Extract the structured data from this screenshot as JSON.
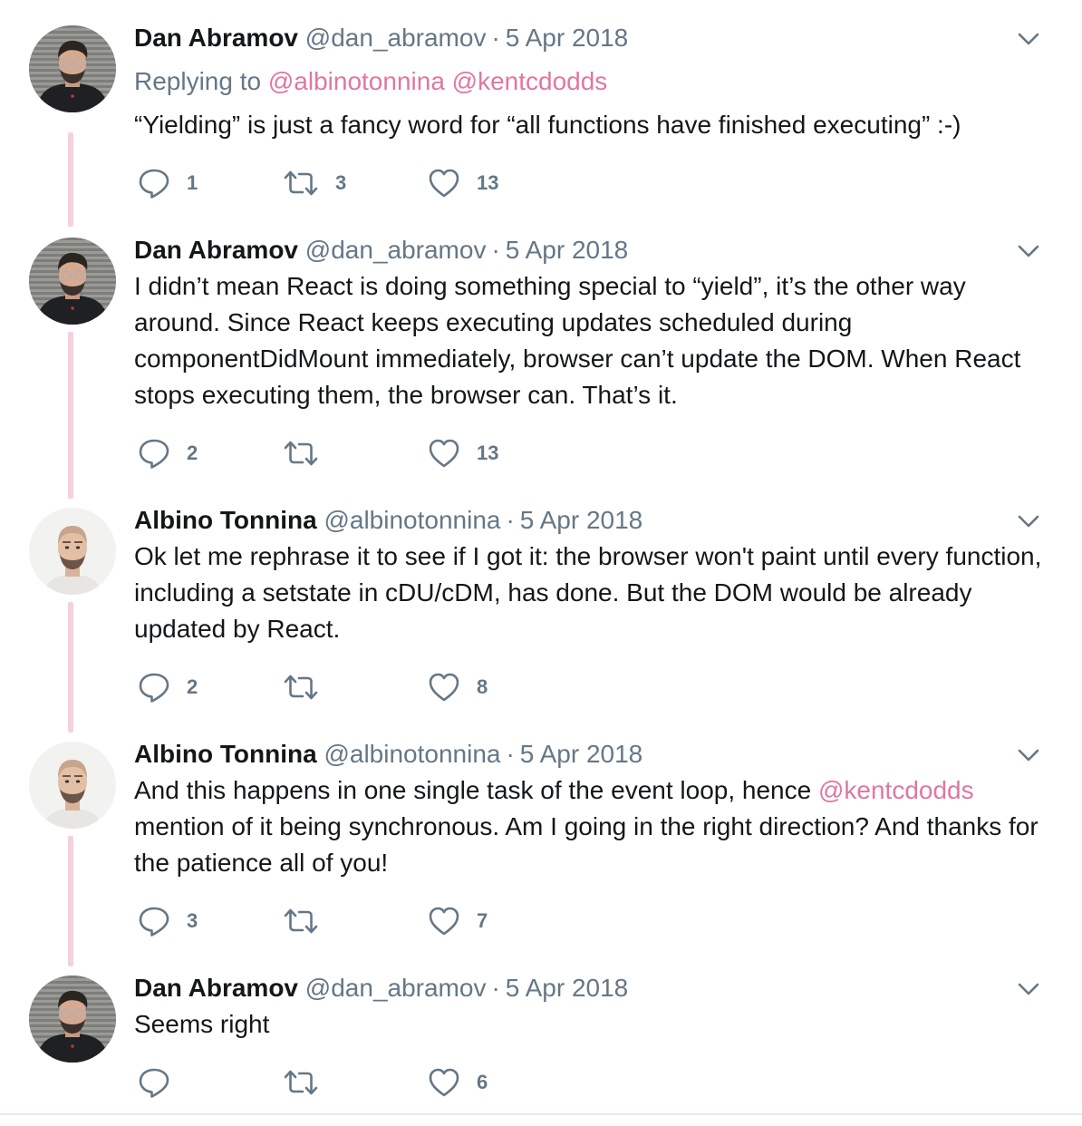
{
  "tweets": [
    {
      "name": "Dan Abramov",
      "handle": "@dan_abramov",
      "separator": "·",
      "date": "5 Apr 2018",
      "replying_prefix": "Replying to",
      "replying_mentions": [
        "@albinotonnina",
        "@kentcdodds"
      ],
      "text": "“Yielding” is just a fancy word for “all functions have finished executing” :-)",
      "replies": "1",
      "retweets": "3",
      "likes": "13",
      "avatar_icon": "dan-abramov-avatar"
    },
    {
      "name": "Dan Abramov",
      "handle": "@dan_abramov",
      "separator": "·",
      "date": "5 Apr 2018",
      "text": "I didn’t mean React is doing something special to “yield”, it’s the other way around. Since React keeps executing updates scheduled during componentDidMount immediately, browser can’t update the DOM. When React stops executing them, the browser can. That’s it.",
      "replies": "2",
      "retweets": "",
      "likes": "13",
      "avatar_icon": "dan-abramov-avatar"
    },
    {
      "name": "Albino Tonnina",
      "handle": "@albinotonnina",
      "separator": "·",
      "date": "5 Apr 2018",
      "text": "Ok let me rephrase it to see if I got it: the browser won't paint until every function, including a setstate in cDU/cDM, has done. But the DOM would be already updated by React.",
      "replies": "2",
      "retweets": "",
      "likes": "8",
      "avatar_icon": "albino-tonnina-avatar"
    },
    {
      "name": "Albino Tonnina",
      "handle": "@albinotonnina",
      "separator": "·",
      "date": "5 Apr 2018",
      "text_before": "And this happens in one single task of the event loop, hence ",
      "text_mention": "@kentcdodds",
      "text_after": " mention of it being synchronous. Am I going in the right direction? And thanks for the patience all of you!",
      "replies": "3",
      "retweets": "",
      "likes": "7",
      "avatar_icon": "albino-tonnina-avatar"
    },
    {
      "name": "Dan Abramov",
      "handle": "@dan_abramov",
      "separator": "·",
      "date": "5 Apr 2018",
      "text": "Seems right",
      "replies": "",
      "retweets": "",
      "likes": "6",
      "avatar_icon": "dan-abramov-avatar"
    }
  ],
  "icons": {
    "reply": "reply-icon",
    "retweet": "retweet-icon",
    "like": "heart-icon",
    "menu": "chevron-down-icon"
  },
  "colors": {
    "name": "#14171a",
    "meta": "#657786",
    "mention": "#e0779f",
    "thread_line": "#f5d0de",
    "divider": "#e6ecf0"
  }
}
